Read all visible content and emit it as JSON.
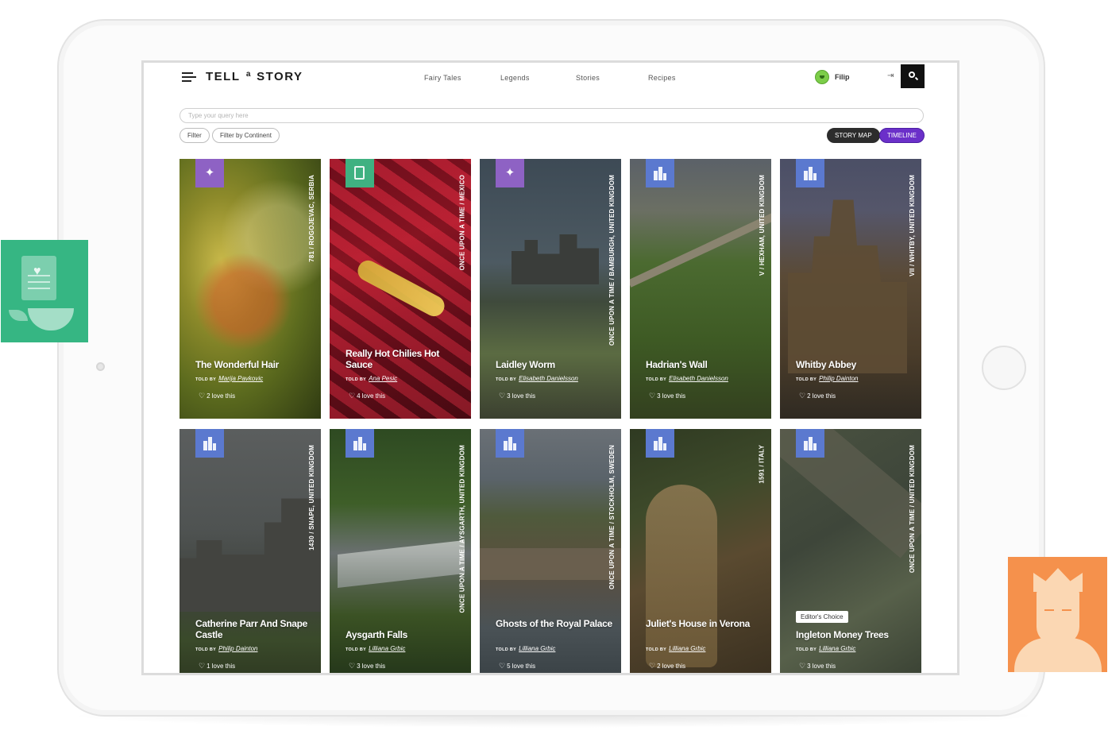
{
  "header": {
    "logo_left": "TELL",
    "logo_mid": "a",
    "logo_right": "STORY",
    "nav": [
      "Fairy Tales",
      "Legends",
      "Stories",
      "Recipes"
    ],
    "user_name": "Filip"
  },
  "search": {
    "placeholder": "Type your query here"
  },
  "filters": {
    "filter": "Filter",
    "filter_continent": "Filter by Continent",
    "story_map": "STORY MAP",
    "timeline": "TIMELINE"
  },
  "colors": {
    "fairy_category": "#8e62c4",
    "recipe_category": "#3fb181",
    "legend_category": "#5b79cf",
    "timeline_active": "#6b30c9"
  },
  "cards": [
    {
      "title": "The Wonderful Hair",
      "told_prefix": "TOLD BY",
      "author": "Marija Pavkovic",
      "loves": "2 love this",
      "location": "781 / ROGOJEVAC, SERBIA",
      "category_icon": "fairy-wand-icon"
    },
    {
      "title": "Really Hot Chilies Hot Sauce",
      "told_prefix": "TOLD BY",
      "author": "Ana Pesic",
      "loves": "4 love this",
      "location": "ONCE UPON A TIME / MEXICO",
      "category_icon": "recipe-document-icon"
    },
    {
      "title": "Laidley Worm",
      "told_prefix": "TOLD BY",
      "author": "Elisabeth Danielsson",
      "loves": "3 love this",
      "location": "ONCE UPON A TIME / BAMBURGH, UNITED KINGDOM",
      "category_icon": "fairy-wand-icon"
    },
    {
      "title": "Hadrian's Wall",
      "told_prefix": "TOLD BY",
      "author": "Elisabeth Danielsson",
      "loves": "3 love this",
      "location": "V / HEXHAM, UNITED KINGDOM",
      "category_icon": "legend-building-icon"
    },
    {
      "title": "Whitby Abbey",
      "told_prefix": "TOLD BY",
      "author": "Philip Dainton",
      "loves": "2 love this",
      "location": "VII / WHITBY, UNITED KINGDOM",
      "category_icon": "legend-building-icon"
    },
    {
      "title": "Catherine Parr And Snape Castle",
      "told_prefix": "TOLD BY",
      "author": "Philip Dainton",
      "loves": "1 love this",
      "location": "1430 / SNAPE, UNITED KINGDOM",
      "category_icon": "legend-building-icon"
    },
    {
      "title": "Aysgarth Falls",
      "told_prefix": "TOLD BY",
      "author": "Lilliana Grbic",
      "loves": "3 love this",
      "location": "ONCE UPON A TIME / AYSGARTH, UNITED KINGDOM",
      "category_icon": "legend-building-icon"
    },
    {
      "title": "Ghosts of the Royal Palace",
      "told_prefix": "TOLD BY",
      "author": "Lilliana Grbic",
      "loves": "5 love this",
      "location": "ONCE UPON A TIME / STOCKHOLM, SWEDEN",
      "category_icon": "legend-building-icon"
    },
    {
      "title": "Juliet's House in Verona",
      "told_prefix": "TOLD BY",
      "author": "Lilliana Grbic",
      "loves": "2 love this",
      "location": "1591 / ITALY",
      "category_icon": "legend-building-icon"
    },
    {
      "title": "Ingleton Money Trees",
      "told_prefix": "TOLD BY",
      "author": "Lilliana Grbic",
      "loves": "3 love this",
      "location": "ONCE UPON A TIME / UNITED KINGDOM",
      "category_icon": "legend-building-icon",
      "badge": "Editor's Choice"
    }
  ]
}
